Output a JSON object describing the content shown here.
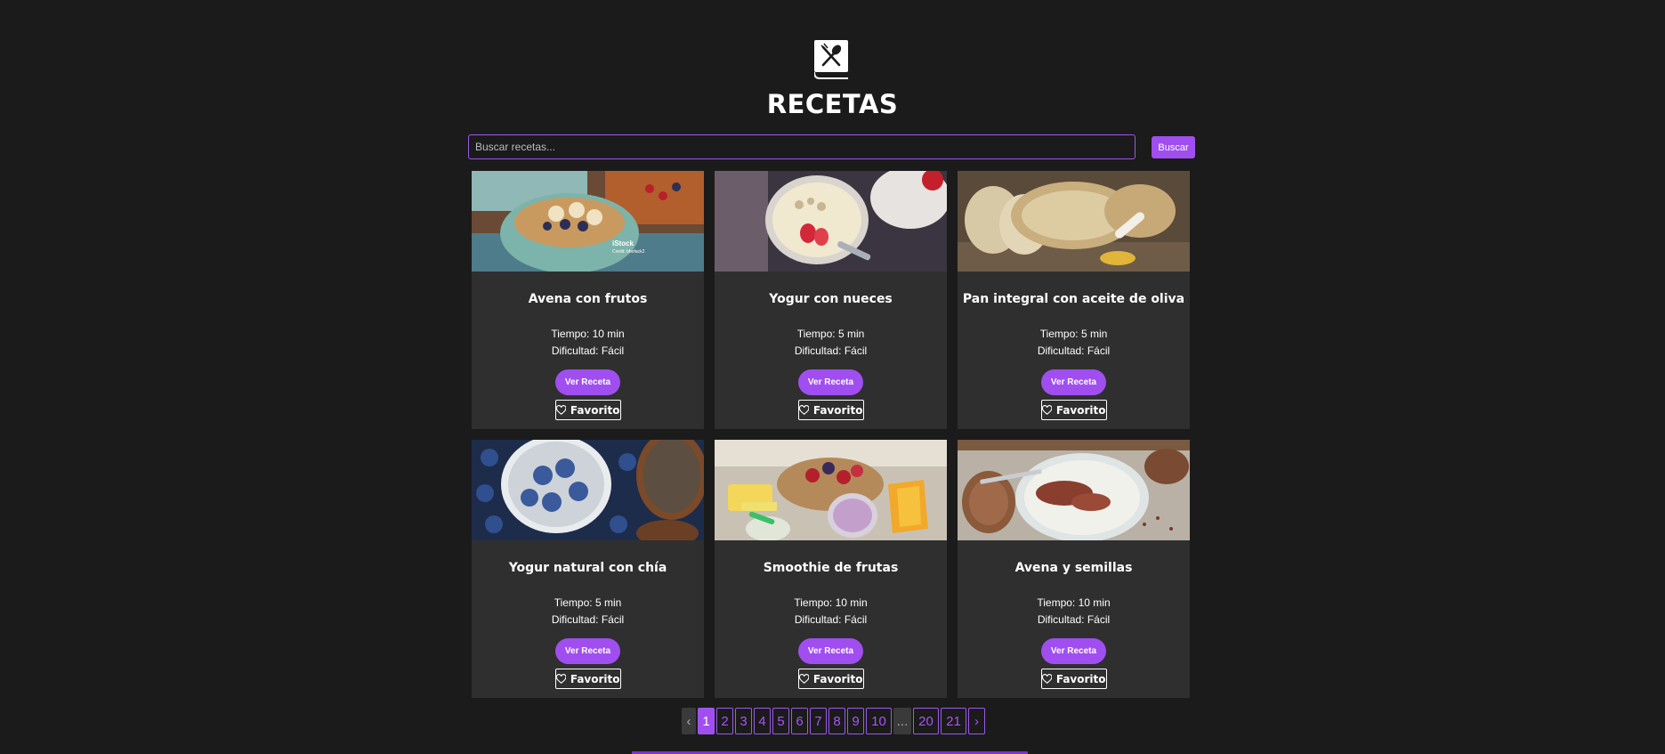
{
  "app": {
    "title": "RECETAS",
    "logo_icon": "recipe-book-icon"
  },
  "search": {
    "placeholder": "Buscar recetas...",
    "value": "",
    "button_label": "Buscar"
  },
  "recipes": [
    {
      "title": "Avena con frutos",
      "time": "Tiempo: 10 min",
      "difficulty": "Dificultad: Fácil",
      "view_label": "Ver Receta",
      "fav_label": "Favorito",
      "image": "oatmeal-bowl-image"
    },
    {
      "title": "Yogur con nueces",
      "time": "Tiempo: 5 min",
      "difficulty": "Dificultad: Fácil",
      "view_label": "Ver Receta",
      "fav_label": "Favorito",
      "image": "yogurt-bowl-image"
    },
    {
      "title": "Pan integral con aceite de oliva",
      "time": "Tiempo: 5 min",
      "difficulty": "Dificultad: Fácil",
      "view_label": "Ver Receta",
      "fav_label": "Favorito",
      "image": "bread-image"
    },
    {
      "title": "Yogur natural con chía",
      "time": "Tiempo: 5 min",
      "difficulty": "Dificultad: Fácil",
      "view_label": "Ver Receta",
      "fav_label": "Favorito",
      "image": "chia-yogurt-image"
    },
    {
      "title": "Smoothie de frutas",
      "time": "Tiempo: 10 min",
      "difficulty": "Dificultad: Fácil",
      "view_label": "Ver Receta",
      "fav_label": "Favorito",
      "image": "fruit-smoothie-image"
    },
    {
      "title": "Avena y semillas",
      "time": "Tiempo: 10 min",
      "difficulty": "Dificultad: Fácil",
      "view_label": "Ver Receta",
      "fav_label": "Favorito",
      "image": "seeds-yogurt-image"
    }
  ],
  "image_watermark": {
    "brand": "iStock",
    "credit": "Credit: bhofack2"
  },
  "pagination": {
    "prev": "‹",
    "pages": [
      "1",
      "2",
      "3",
      "4",
      "5",
      "6",
      "7",
      "8",
      "9",
      "10"
    ],
    "ellipsis": "...",
    "last_pages": [
      "20",
      "21"
    ],
    "next": "›",
    "current": "1"
  },
  "colors": {
    "accent": "#a04ef0",
    "background": "#1b1b1b",
    "card": "#2f2f2f"
  }
}
